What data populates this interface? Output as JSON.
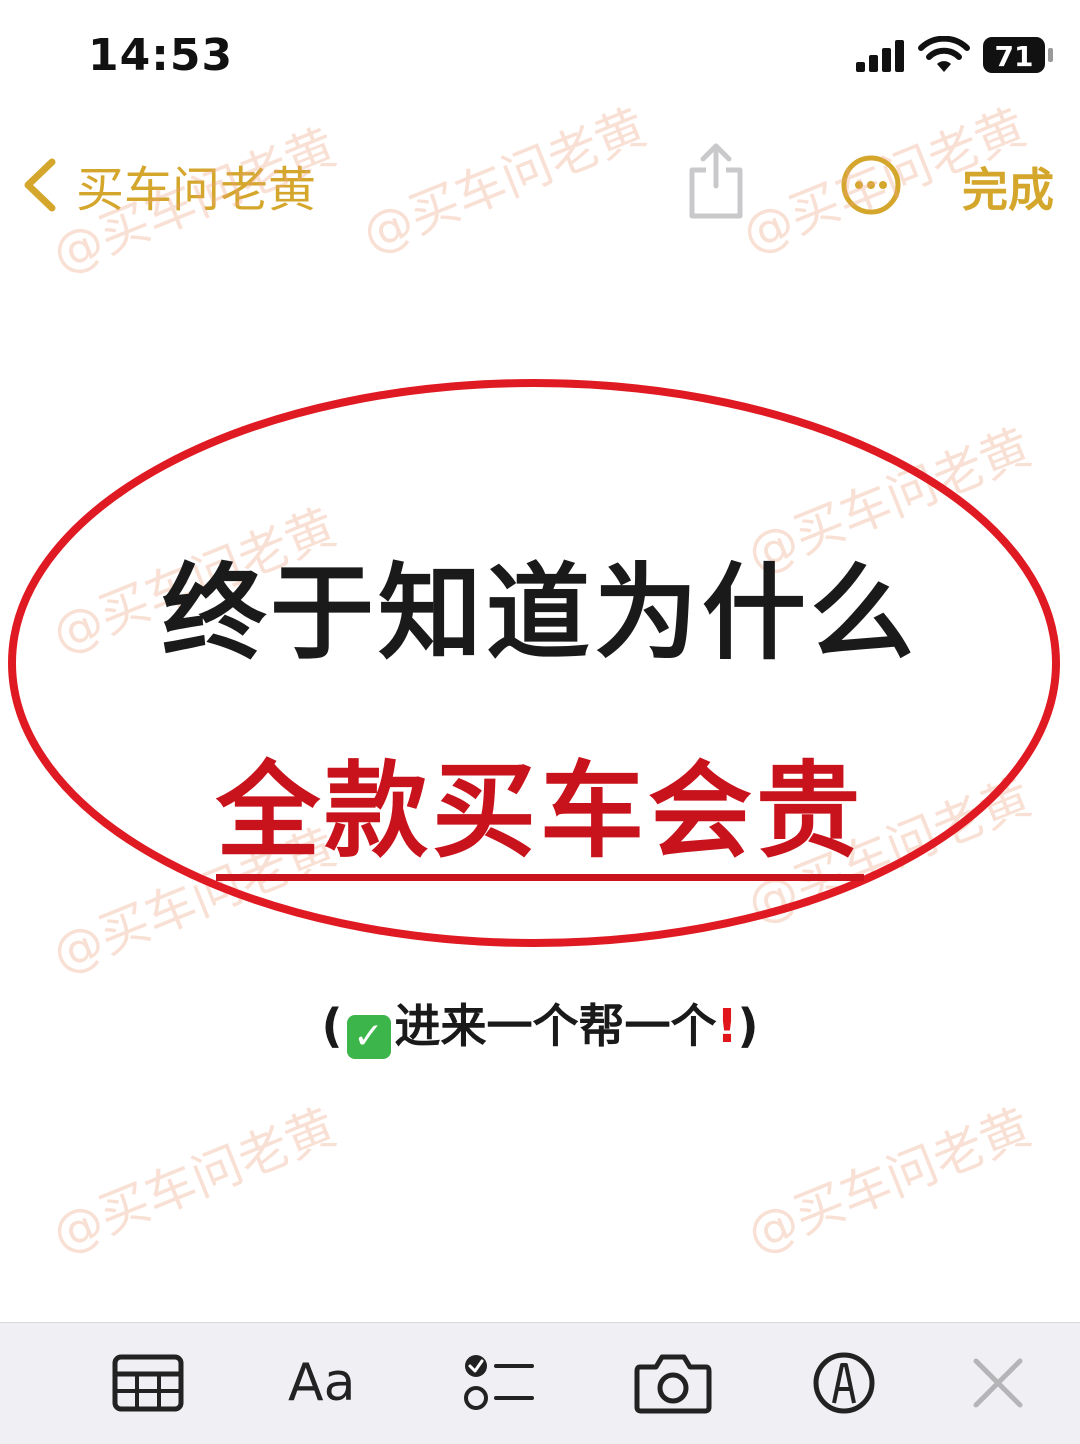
{
  "status_bar": {
    "time": "14:53",
    "battery": "71",
    "icons": [
      "signal-icon",
      "wifi-icon",
      "battery-icon"
    ]
  },
  "nav_bar": {
    "back_label": "买车问老黄",
    "done_label": "完成",
    "icons": [
      "chevron-left-icon",
      "share-icon",
      "more-icon"
    ],
    "accent_color": "#d4a72c"
  },
  "watermark_text": "@买车问老黄",
  "content": {
    "line1": "终于知道为什么",
    "line2": "全款买车会贵",
    "subline_open": "(",
    "subline_check": "✓",
    "subline_text": "进来一个帮一个",
    "subline_exclaim": "!",
    "subline_close": ")",
    "highlight_color": "#c8131c",
    "ellipse_color": "#e01a22"
  },
  "toolbar": {
    "format_label": "Aa",
    "icons": [
      "table-icon",
      "format-icon",
      "checklist-icon",
      "camera-icon",
      "markup-icon",
      "close-icon"
    ]
  }
}
